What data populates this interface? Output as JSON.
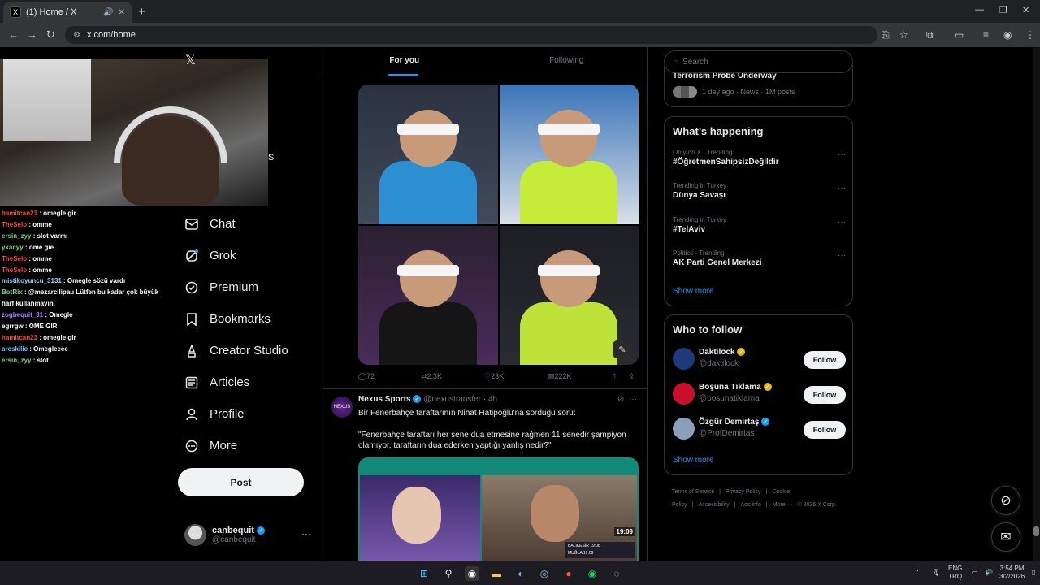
{
  "browser": {
    "tab_title": "(1) Home / X",
    "tab_icon": "X",
    "url": "x.com/home"
  },
  "stream_chat": [
    {
      "user": "hamitcan21",
      "msg": ": omegle gir",
      "color": "u1"
    },
    {
      "user": "TheSelo",
      "msg": ": omme",
      "color": "u1"
    },
    {
      "user": "ersin_zyy",
      "msg": ": slot varmı",
      "color": "u2"
    },
    {
      "user": "yxacyy",
      "msg": ": ome gie",
      "color": "u2"
    },
    {
      "user": "TheSelo",
      "msg": ": omme",
      "color": "u1"
    },
    {
      "user": "TheSelo",
      "msg": ": omme",
      "color": "u1"
    },
    {
      "user": "mistikoyuncu_3131",
      "msg": ": Omegle sözü vardı",
      "color": "u5"
    },
    {
      "user": "BotRix",
      "msg": ": @mezarcilipau Lütfen bu kadar çok büyük harf kullanmayın.",
      "color": "u2"
    },
    {
      "user": "zogbequit_31",
      "msg": ": Omegle",
      "color": "u3"
    },
    {
      "user": "egrrgw",
      "msg": ": OME GİR",
      "color": "u0"
    },
    {
      "user": "hamitcan21",
      "msg": ": omegle gir",
      "color": "u1"
    },
    {
      "user": "areskilic",
      "msg": ": Omegleeee",
      "color": "u4"
    },
    {
      "user": "ersin_zyy",
      "msg": ": slot",
      "color": "u2"
    }
  ],
  "sidebar": {
    "logo": "𝕏",
    "stray": "S",
    "items": [
      {
        "label": "Chat",
        "icon": "mail-icon"
      },
      {
        "label": "Grok",
        "icon": "grok-icon"
      },
      {
        "label": "Premium",
        "icon": "premium-icon"
      },
      {
        "label": "Bookmarks",
        "icon": "bookmark-icon"
      },
      {
        "label": "Creator Studio",
        "icon": "creator-icon"
      },
      {
        "label": "Articles",
        "icon": "articles-icon"
      },
      {
        "label": "Profile",
        "icon": "profile-icon"
      },
      {
        "label": "More",
        "icon": "more-icon"
      }
    ],
    "post_label": "Post",
    "account": {
      "name": "canbequit",
      "handle": "@canbequit"
    }
  },
  "timeline": {
    "tabs": [
      {
        "label": "For you",
        "active": true
      },
      {
        "label": "Following",
        "active": false
      }
    ],
    "tweet1_actions": {
      "replies": "72",
      "reposts": "2.3K",
      "likes": "23K",
      "views": "222K"
    },
    "tweet2": {
      "name": "Nexus Sports",
      "handle": "@nexustransfer",
      "time": "· 4h",
      "avatar_text": "NEXUS",
      "text_line1": "Bir Fenerbahçe taraftarının Nihat Hatipoğlu'na sorduğu soru:",
      "text_line2": "\"Fenerbahçe taraftarı her sene dua etmesine rağmen 11 senedir şampiyon olamıyor, taraftarın dua ederken yaptığı yanlış nedir?\"",
      "clock": "19:09",
      "ticker": [
        "BALIKESİR  19:08",
        "MUĞLA  19:09"
      ]
    }
  },
  "right": {
    "search_placeholder": "Search",
    "top_news": {
      "title": "Terrorism Probe Underway",
      "meta": "1 day ago · News · 1M posts"
    },
    "whats_happening": {
      "title": "What’s happening",
      "trends": [
        {
          "context": "Only on X · Trending",
          "title": "#ÖğretmenSahipsizDeğildir"
        },
        {
          "context": "Trending in Turkey",
          "title": "Dünya Savaşı"
        },
        {
          "context": "Trending in Turkey",
          "title": "#TelAviv"
        },
        {
          "context": "Politics · Trending",
          "title": "AK Parti Genel Merkezi"
        }
      ],
      "show_more": "Show more"
    },
    "who_to_follow": {
      "title": "Who to follow",
      "accounts": [
        {
          "name": "Daktilock",
          "handle": "@daktilock",
          "badge": "gold",
          "color": "#1d3a7a"
        },
        {
          "name": "Boşuna Tıklama",
          "handle": "@bosunatiklama",
          "badge": "gold",
          "color": "#c8102e"
        },
        {
          "name": "Özgür Demirtaş",
          "handle": "@ProfDemirtas",
          "badge": "blue",
          "color": "#8aa0b8"
        }
      ],
      "follow_label": "Follow",
      "show_more": "Show more"
    },
    "footer": [
      "Terms of Service",
      "|",
      "Privacy Policy",
      "|",
      "Cookie Policy",
      "|",
      "Accessibility",
      "|",
      "Ads info",
      "|",
      "More ···",
      "© 2026 X Corp."
    ]
  },
  "taskbar": {
    "lang_top": "ENG",
    "lang_bottom": "TRQ",
    "time": "3:54 PM",
    "date": "3/2/2026"
  }
}
